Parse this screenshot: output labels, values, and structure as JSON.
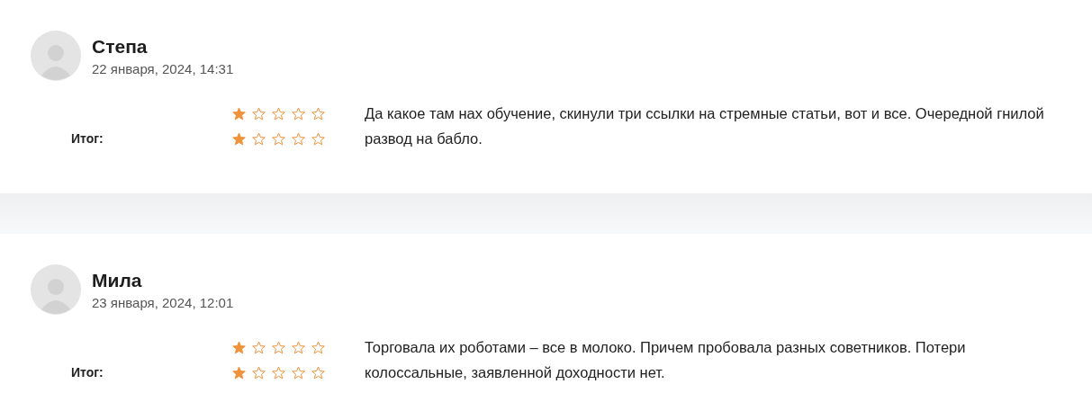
{
  "reviews": [
    {
      "name": "Степа",
      "date": "22 января, 2024, 14:31",
      "ratings": [
        {
          "stars": 1
        },
        {
          "label": "Итог:",
          "stars": 1
        }
      ],
      "text": "Да какое там нах обучение, скинули три ссылки на стремные статьи, вот и все. Очередной гнилой развод на бабло."
    },
    {
      "name": "Мила",
      "date": "23 января, 2024, 12:01",
      "ratings": [
        {
          "stars": 1
        },
        {
          "label": "Итог:",
          "stars": 1
        }
      ],
      "text": "Торговала их роботами – все в молоко. Причем пробовала разных советников. Потери колоссальные, заявленной доходности нет."
    }
  ]
}
